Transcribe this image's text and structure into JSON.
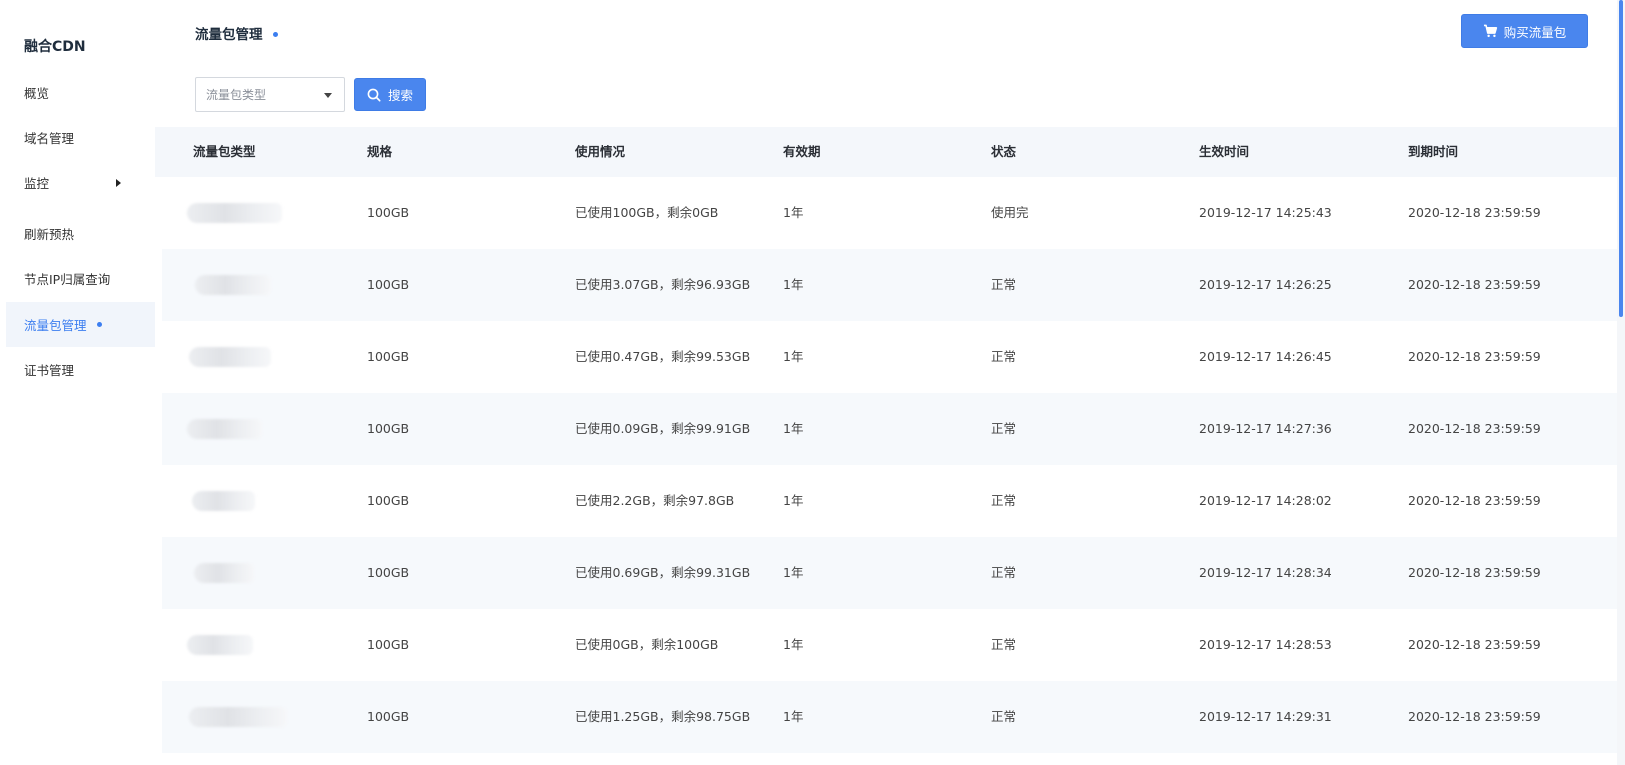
{
  "sidebar": {
    "title": "融合CDN",
    "items": [
      {
        "label": "概览"
      },
      {
        "label": "域名管理"
      },
      {
        "label": "监控"
      },
      {
        "label": "刷新预热"
      },
      {
        "label": "节点IP归属查询"
      },
      {
        "label": "流量包管理"
      },
      {
        "label": "证书管理"
      }
    ]
  },
  "header": {
    "title": "流量包管理",
    "buy_label": "购买流量包"
  },
  "filter": {
    "select_placeholder": "流量包类型",
    "search_label": "搜索"
  },
  "table": {
    "columns": [
      "流量包类型",
      "规格",
      "使用情况",
      "有效期",
      "状态",
      "生效时间",
      "到期时间"
    ],
    "rows": [
      {
        "spec": "100GB",
        "usage": "已使用100GB，剩余0GB",
        "validity": "1年",
        "status": "使用完",
        "start": "2019-12-17 14:25:43",
        "end": "2020-12-18 23:59:59"
      },
      {
        "spec": "100GB",
        "usage": "已使用3.07GB，剩余96.93GB",
        "validity": "1年",
        "status": "正常",
        "start": "2019-12-17 14:26:25",
        "end": "2020-12-18 23:59:59"
      },
      {
        "spec": "100GB",
        "usage": "已使用0.47GB，剩余99.53GB",
        "validity": "1年",
        "status": "正常",
        "start": "2019-12-17 14:26:45",
        "end": "2020-12-18 23:59:59"
      },
      {
        "spec": "100GB",
        "usage": "已使用0.09GB，剩余99.91GB",
        "validity": "1年",
        "status": "正常",
        "start": "2019-12-17 14:27:36",
        "end": "2020-12-18 23:59:59"
      },
      {
        "spec": "100GB",
        "usage": "已使用2.2GB，剩余97.8GB",
        "validity": "1年",
        "status": "正常",
        "start": "2019-12-17 14:28:02",
        "end": "2020-12-18 23:59:59"
      },
      {
        "spec": "100GB",
        "usage": "已使用0.69GB，剩余99.31GB",
        "validity": "1年",
        "status": "正常",
        "start": "2019-12-17 14:28:34",
        "end": "2020-12-18 23:59:59"
      },
      {
        "spec": "100GB",
        "usage": "已使用0GB，剩余100GB",
        "validity": "1年",
        "status": "正常",
        "start": "2019-12-17 14:28:53",
        "end": "2020-12-18 23:59:59"
      },
      {
        "spec": "100GB",
        "usage": "已使用1.25GB，剩余98.75GB",
        "validity": "1年",
        "status": "正常",
        "start": "2019-12-17 14:29:31",
        "end": "2020-12-18 23:59:59"
      }
    ]
  },
  "colors": {
    "accent": "#4a86ee",
    "active_text": "#3c7ef0",
    "header_bg": "#f4f7fb"
  },
  "icons": {
    "cart": "cart-icon",
    "search": "search-icon",
    "caret": "caret-down-icon",
    "submenu": "caret-right-icon"
  }
}
